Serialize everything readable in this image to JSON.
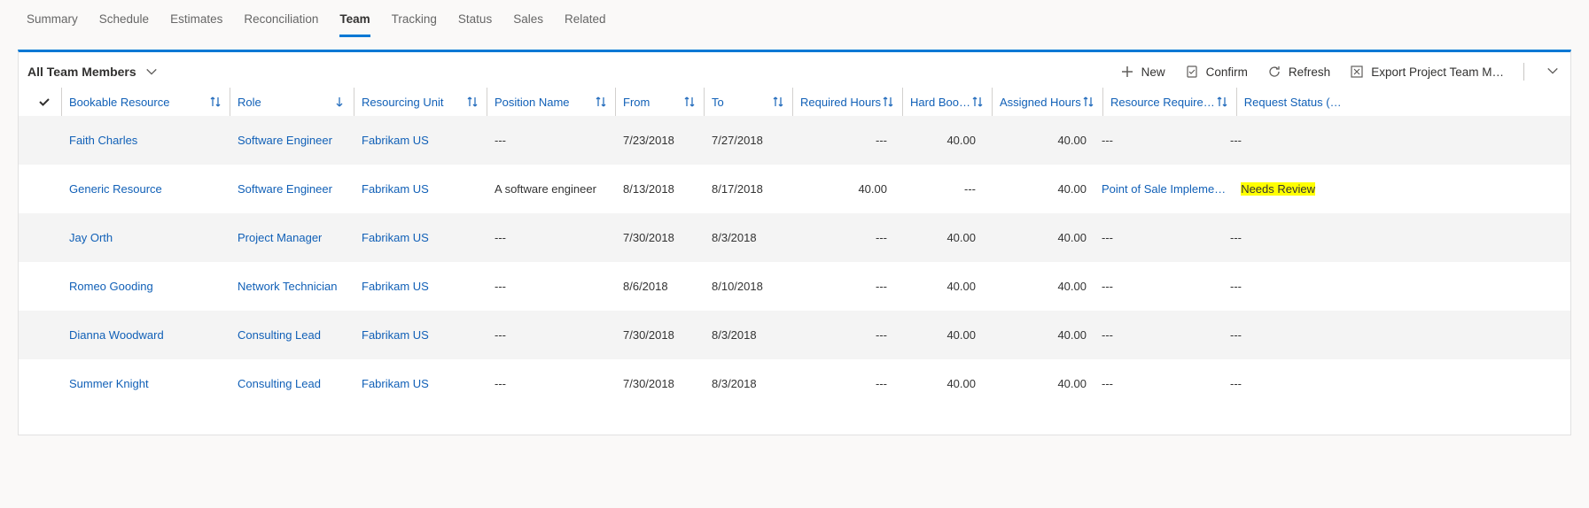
{
  "tabs": [
    {
      "label": "Summary"
    },
    {
      "label": "Schedule"
    },
    {
      "label": "Estimates"
    },
    {
      "label": "Reconciliation"
    },
    {
      "label": "Team",
      "active": true
    },
    {
      "label": "Tracking"
    },
    {
      "label": "Status"
    },
    {
      "label": "Sales"
    },
    {
      "label": "Related"
    }
  ],
  "view": {
    "title": "All Team Members"
  },
  "toolbar": {
    "new_label": "New",
    "confirm_label": "Confirm",
    "refresh_label": "Refresh",
    "export_label": "Export Project Team M…"
  },
  "columns": {
    "bookable": "Bookable Resource",
    "role": "Role",
    "unit": "Resourcing Unit",
    "position": "Position Name",
    "from": "From",
    "to": "To",
    "required": "Required Hours",
    "hard": "Hard Boo…",
    "assigned": "Assigned Hours",
    "resource_req": "Resource Require…",
    "request_status": "Request Status (…"
  },
  "rows": [
    {
      "bookable": "Faith Charles",
      "role": "Software Engineer",
      "unit": "Fabrikam US",
      "position": "---",
      "from": "7/23/2018",
      "to": "7/27/2018",
      "required": "---",
      "hard": "40.00",
      "assigned": "40.00",
      "resource_req": "---",
      "request_status": "---",
      "highlight": false
    },
    {
      "bookable": "Generic Resource",
      "role": "Software Engineer",
      "unit": "Fabrikam US",
      "position": "A software engineer",
      "from": "8/13/2018",
      "to": "8/17/2018",
      "required": "40.00",
      "hard": "---",
      "assigned": "40.00",
      "resource_req": "Point of Sale Impleme…",
      "request_status": "Needs Review",
      "highlight": true
    },
    {
      "bookable": "Jay Orth",
      "role": "Project Manager",
      "unit": "Fabrikam US",
      "position": "---",
      "from": "7/30/2018",
      "to": "8/3/2018",
      "required": "---",
      "hard": "40.00",
      "assigned": "40.00",
      "resource_req": "---",
      "request_status": "---",
      "highlight": false
    },
    {
      "bookable": "Romeo Gooding",
      "role": "Network Technician",
      "unit": "Fabrikam US",
      "position": "---",
      "from": "8/6/2018",
      "to": "8/10/2018",
      "required": "---",
      "hard": "40.00",
      "assigned": "40.00",
      "resource_req": "---",
      "request_status": "---",
      "highlight": false
    },
    {
      "bookable": "Dianna Woodward",
      "role": "Consulting Lead",
      "unit": "Fabrikam US",
      "position": "---",
      "from": "7/30/2018",
      "to": "8/3/2018",
      "required": "---",
      "hard": "40.00",
      "assigned": "40.00",
      "resource_req": "---",
      "request_status": "---",
      "highlight": false
    },
    {
      "bookable": "Summer Knight",
      "role": "Consulting Lead",
      "unit": "Fabrikam US",
      "position": "---",
      "from": "7/30/2018",
      "to": "8/3/2018",
      "required": "---",
      "hard": "40.00",
      "assigned": "40.00",
      "resource_req": "---",
      "request_status": "---",
      "highlight": false
    }
  ]
}
